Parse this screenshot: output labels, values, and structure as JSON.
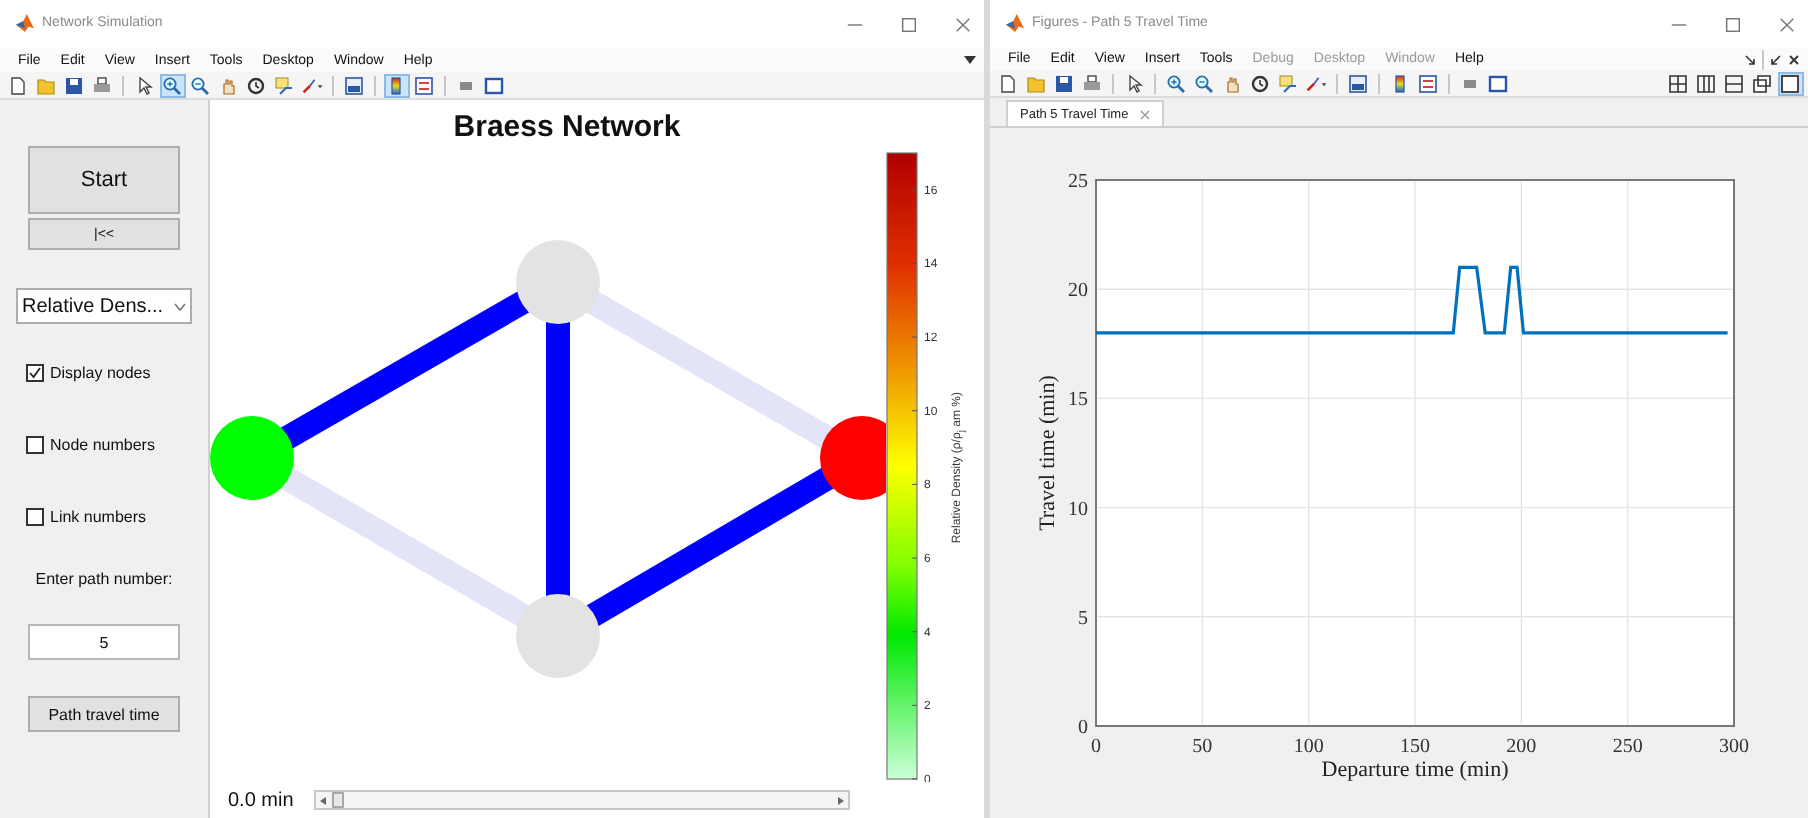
{
  "network_window": {
    "title": "Network Simulation",
    "menu": [
      {
        "label": "File",
        "disabled": false
      },
      {
        "label": "Edit",
        "disabled": false
      },
      {
        "label": "View",
        "disabled": false
      },
      {
        "label": "Insert",
        "disabled": false
      },
      {
        "label": "Tools",
        "disabled": false
      },
      {
        "label": "Desktop",
        "disabled": false
      },
      {
        "label": "Window",
        "disabled": false
      },
      {
        "label": "Help",
        "disabled": false
      }
    ],
    "toolbar": [
      {
        "kind": "new",
        "selected": false
      },
      {
        "kind": "open",
        "selected": false
      },
      {
        "kind": "save",
        "selected": false
      },
      {
        "kind": "print",
        "selected": false
      },
      {
        "kind": "separator"
      },
      {
        "kind": "pointer",
        "selected": false
      },
      {
        "kind": "zoom-in",
        "selected": true
      },
      {
        "kind": "zoom-out",
        "selected": false
      },
      {
        "kind": "pan",
        "selected": false
      },
      {
        "kind": "rotate",
        "selected": false
      },
      {
        "kind": "datatip",
        "selected": false
      },
      {
        "kind": "brush",
        "selected": false
      },
      {
        "kind": "separator"
      },
      {
        "kind": "link",
        "selected": false
      },
      {
        "kind": "separator"
      },
      {
        "kind": "colorbar",
        "selected": true
      },
      {
        "kind": "legend",
        "selected": false
      },
      {
        "kind": "separator"
      },
      {
        "kind": "hide",
        "selected": false
      },
      {
        "kind": "show",
        "selected": false
      }
    ],
    "controls": {
      "start_button": "Start",
      "rewind_button": "|<<",
      "display_dropdown": {
        "value": "Relative Dens..."
      },
      "checkboxes": [
        {
          "label": "Display nodes",
          "checked": true
        },
        {
          "label": "Node numbers",
          "checked": false
        },
        {
          "label": "Link numbers",
          "checked": false
        }
      ],
      "path_prompt": "Enter path number:",
      "path_field": {
        "value": "5"
      },
      "path_button": "Path travel time"
    },
    "plot": {
      "title": "Braess Network",
      "nodes": [
        {
          "color": "#00ff00"
        },
        {
          "color": "#e3e3e3"
        },
        {
          "color": "#e3e3e3"
        },
        {
          "color": "#ff0000"
        }
      ],
      "links": [
        {
          "color": "#0000ff"
        },
        {
          "color": "#0000ff"
        },
        {
          "color": "#0000ff"
        },
        {
          "color": "#e4e4f8"
        },
        {
          "color": "#e4e4f8"
        }
      ],
      "colorbar": {
        "label": "Relative Density (ρ/ρ$_{j}$ am %)",
        "ticks": [
          "16",
          "14",
          "12",
          "10",
          "8",
          "6",
          "4",
          "2",
          "0"
        ]
      }
    },
    "time_slider": {
      "reading": "0.0 min"
    }
  },
  "figures_window": {
    "title": "Figures - Path 5 Travel Time",
    "menu": [
      {
        "label": "File",
        "disabled": false
      },
      {
        "label": "Edit",
        "disabled": false
      },
      {
        "label": "View",
        "disabled": false
      },
      {
        "label": "Insert",
        "disabled": false
      },
      {
        "label": "Tools",
        "disabled": false
      },
      {
        "label": "Debug",
        "disabled": true
      },
      {
        "label": "Desktop",
        "disabled": true
      },
      {
        "label": "Window",
        "disabled": true
      },
      {
        "label": "Help",
        "disabled": false
      }
    ],
    "toolbar": [
      {
        "kind": "new",
        "selected": false
      },
      {
        "kind": "open",
        "selected": false
      },
      {
        "kind": "save",
        "selected": false
      },
      {
        "kind": "print",
        "selected": false
      },
      {
        "kind": "separator"
      },
      {
        "kind": "pointer",
        "selected": false
      },
      {
        "kind": "separator"
      },
      {
        "kind": "zoom-in",
        "selected": false
      },
      {
        "kind": "zoom-out",
        "selected": false
      },
      {
        "kind": "pan",
        "selected": false
      },
      {
        "kind": "rotate",
        "selected": false
      },
      {
        "kind": "datatip",
        "selected": false
      },
      {
        "kind": "brush",
        "selected": false
      },
      {
        "kind": "separator"
      },
      {
        "kind": "link",
        "selected": false
      },
      {
        "kind": "separator"
      },
      {
        "kind": "colorbar",
        "selected": false
      },
      {
        "kind": "legend",
        "selected": false
      },
      {
        "kind": "separator"
      },
      {
        "kind": "hide",
        "selected": false
      },
      {
        "kind": "show",
        "selected": false
      }
    ],
    "layout_buttons": [
      {
        "kind": "grid",
        "selected": false
      },
      {
        "kind": "columns",
        "selected": false
      },
      {
        "kind": "rows",
        "selected": false
      },
      {
        "kind": "float",
        "selected": false
      },
      {
        "kind": "maximize",
        "selected": true
      }
    ],
    "tabs": [
      {
        "label": "Path 5 Travel Time",
        "selected": true
      }
    ],
    "chart_data": {
      "type": "line",
      "xlabel": "Departure time (min)",
      "ylabel": "Travel time (min)",
      "x": [
        0,
        168,
        171,
        179,
        183,
        192,
        195,
        198,
        201,
        297
      ],
      "series": [
        {
          "color": "#0072bd",
          "values": [
            18,
            18,
            21,
            21,
            18,
            18,
            21,
            21,
            18,
            18
          ]
        }
      ],
      "grid": true,
      "xlim": [
        0,
        300
      ],
      "ylim": [
        0,
        25
      ],
      "xticks": [
        0,
        50,
        100,
        150,
        200,
        250,
        300
      ],
      "yticks": [
        0,
        5,
        10,
        15,
        20,
        25
      ]
    }
  }
}
